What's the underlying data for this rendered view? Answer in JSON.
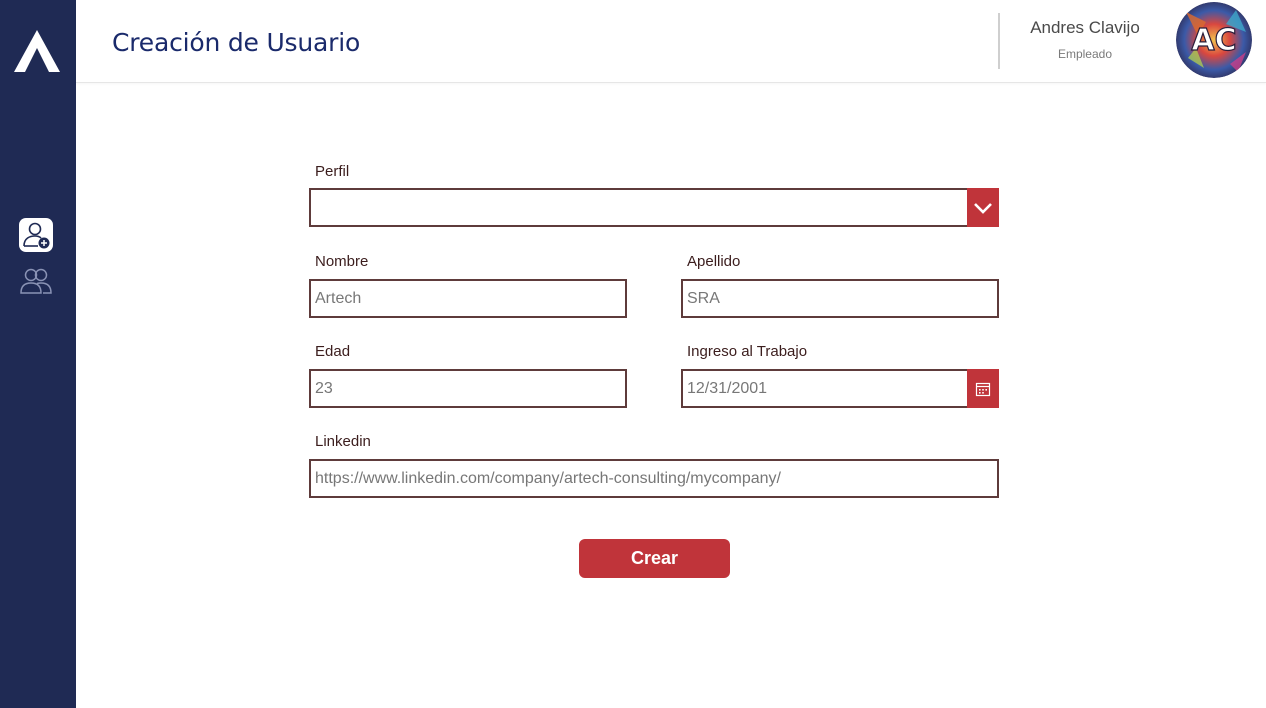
{
  "header": {
    "title": "Creación de Usuario",
    "user_name": "Andres Clavijo",
    "user_role": "Empleado",
    "avatar_text": "AC"
  },
  "sidebar": {
    "items": [
      {
        "icon": "user-add-icon",
        "active": true
      },
      {
        "icon": "users-icon",
        "active": false
      }
    ]
  },
  "form": {
    "perfil": {
      "label": "Perfil",
      "value": ""
    },
    "nombre": {
      "label": "Nombre",
      "placeholder": "Artech"
    },
    "apellido": {
      "label": "Apellido",
      "placeholder": "SRA"
    },
    "edad": {
      "label": "Edad",
      "placeholder": "23"
    },
    "ingreso": {
      "label": "Ingreso al Trabajo",
      "placeholder": "12/31/2001"
    },
    "linkedin": {
      "label": "Linkedin",
      "placeholder": "https://www.linkedin.com/company/artech-consulting/mycompany/"
    },
    "submit_label": "Crear"
  },
  "colors": {
    "sidebar": "#1f2a54",
    "accent": "#c0343a",
    "title": "#1a2a6b",
    "field_border": "#5e3b3b"
  }
}
